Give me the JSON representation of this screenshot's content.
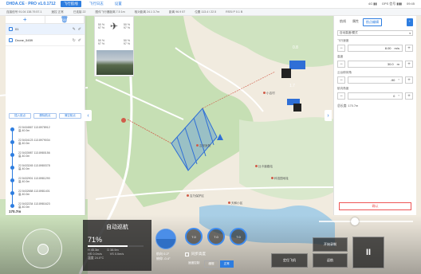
{
  "app": {
    "brand": "DHDA.CE · PRO v1.0.1712",
    "menu": [
      "飞行航线",
      "飞行日志",
      "设置"
    ],
    "active_menu": 0,
    "status_right": [
      "4G ▮▮",
      "GPS 信号 ▮▮▮",
      "09:45"
    ]
  },
  "status_items": [
    "连接信号 91.04 138.79.57.1",
    "遥控 正常",
    "已连接 22",
    "图传飞行器距离 7.5 1m",
    "相对距离 24.1 3.7m",
    "距离 96.9 57",
    "位置 113.4 / 22.5",
    "RSSI P 0.1 B"
  ],
  "left_panel": {
    "add_label": "+",
    "delete_label": "🗑",
    "files": [
      {
        "name": "01"
      },
      {
        "name": "Drone_5459"
      }
    ],
    "tools": [
      "插入航点",
      "删除航点",
      "清空航点"
    ],
    "waypoints": [
      {
        "l1": "22.5434567 113.8978912",
        "l2": "高 40.0m"
      },
      {
        "l1": "22.5434123 113.8979034",
        "l2": "高 40.0m"
      },
      {
        "l1": "22.5433987 113.8980156",
        "l2": "高 40.0m"
      },
      {
        "l1": "22.5433245 113.8980378",
        "l2": "高 40.0m"
      },
      {
        "l1": "22.5432901 113.8981290",
        "l2": "高 40.0m"
      },
      {
        "l1": "22.5432658 113.8981401",
        "l2": "高 40.0m"
      },
      {
        "l1": "22.5432234 113.8981623",
        "l2": "高 40.0m"
      }
    ],
    "total_label": "170.7m",
    "total_sub": "航线总长"
  },
  "drone_widget": {
    "tl": "50 %",
    "tl2": "97 %",
    "tr": "50 %",
    "tr2": "97 %",
    "bl": "50 %",
    "bl2": "97 %",
    "br": "50 %",
    "br2": "97 %"
  },
  "map": {
    "labels": [
      "吉安医院",
      "小吉村",
      "比卡道路站",
      "吉乃保护区",
      "天和小区",
      "科技园地址"
    ],
    "altitude_badges": [
      "0.8",
      "1.7"
    ]
  },
  "right_panel": {
    "tabs": [
      "航线",
      "属性",
      "航点编辑"
    ],
    "active_tab": 2,
    "mode_select": "自动高度/模式",
    "sections": [
      {
        "label": "飞行速度",
        "value": "8.00",
        "unit": "m/s"
      },
      {
        "label": "高度",
        "value": "30.0",
        "unit": "m"
      },
      {
        "label": "云台俯仰角",
        "value": "-90",
        "unit": "°"
      },
      {
        "label": "航向角度",
        "value": "0",
        "unit": "°"
      }
    ],
    "info": "总长度: 170.7m",
    "end_button": "确认"
  },
  "hud": {
    "mode_label": "自动巡航",
    "battery": "71%",
    "battery_fraction": 0.71,
    "stats": [
      [
        "H 45.3m",
        "D 38.9m"
      ],
      [
        "HS 0.0m/s",
        "VS 0.0m/s"
      ],
      [
        "温度 24.0°C",
        ""
      ]
    ],
    "gimbals": [
      "7.0",
      "7.0",
      "7.0"
    ],
    "attrs": [
      "航向  0.2°",
      "俯仰  -0.4°"
    ],
    "sync_label": "同步高度",
    "seg_label": "速度控制",
    "seg_options": [
      "缓慢",
      "正常"
    ],
    "seg_active": 1,
    "btn_record": "开始录制",
    "btn_locate": "定位飞机",
    "btn_return": "返航",
    "pause_glyph": "II"
  }
}
